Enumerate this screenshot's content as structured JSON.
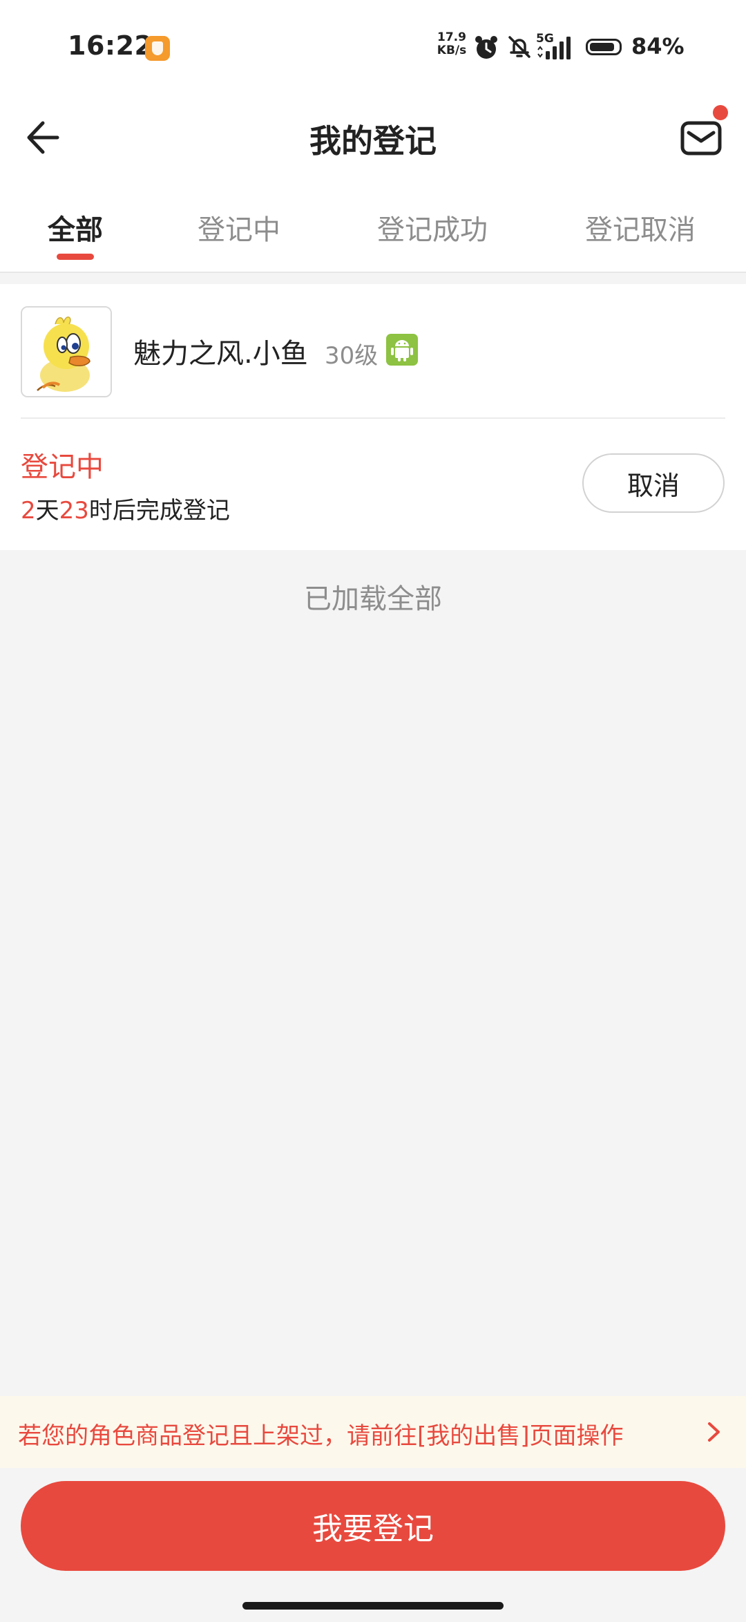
{
  "status_bar": {
    "time": "16:22",
    "net_speed_value": "17.9",
    "net_speed_unit": "KB/s",
    "network_type": "5G",
    "battery": "84%"
  },
  "header": {
    "title": "我的登记",
    "back_icon": "arrow-left-icon",
    "mail_icon": "mail-icon"
  },
  "tabs": [
    {
      "label": "全部",
      "active": true
    },
    {
      "label": "登记中",
      "active": false
    },
    {
      "label": "登记成功",
      "active": false
    },
    {
      "label": "登记取消",
      "active": false
    }
  ],
  "registration": {
    "role_name": "魅力之风.小鱼",
    "level": "30级",
    "platform_icon": "android-icon",
    "status": "登记中",
    "countdown": {
      "days": "2",
      "days_unit": "天",
      "hours": "23",
      "suffix": "时后完成登记"
    },
    "cancel_label": "取消"
  },
  "list_footer": "已加载全部",
  "notice": {
    "text": "若您的角色商品登记且上架过，请前往[我的出售]页面操作"
  },
  "register_button": "我要登记",
  "colors": {
    "accent": "#e8493e",
    "notice_bg": "#fdf8ec",
    "page_bg": "#f4f4f4",
    "android_green": "#8dc242"
  }
}
